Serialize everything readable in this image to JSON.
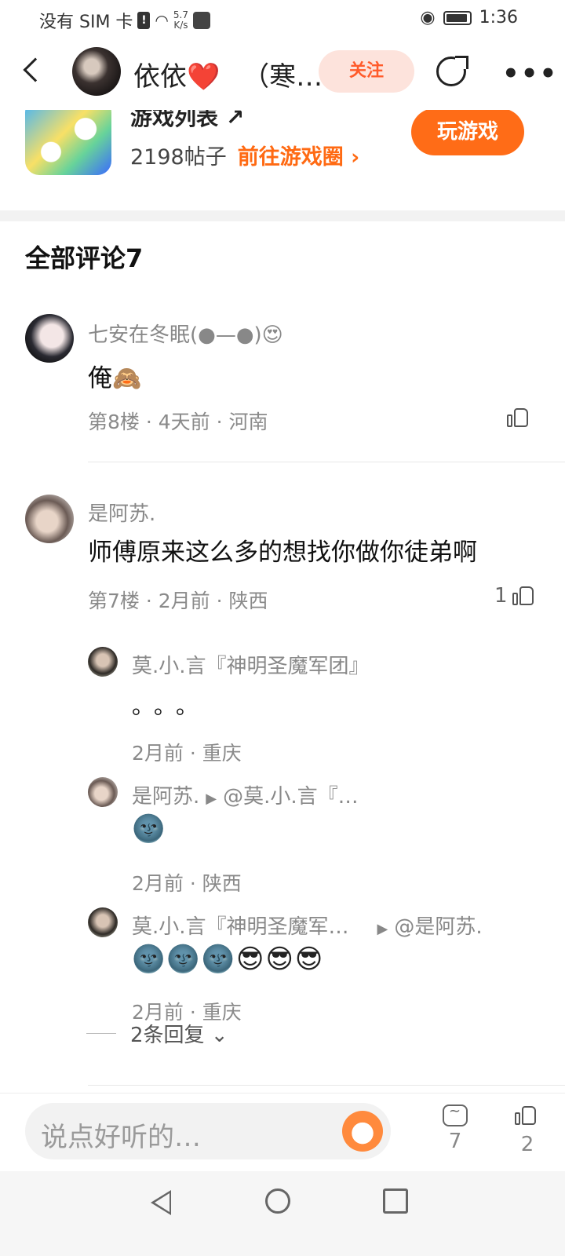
{
  "status_bar": {
    "sim_text": "没有 SIM 卡",
    "net_speed_value": "5.7",
    "net_speed_unit": "K/s",
    "time": "1:36"
  },
  "header": {
    "user_name": "依依",
    "heart_emoji": "❤️",
    "title_suffix": "（寒…",
    "follow_label": "关注",
    "more_label": "•••"
  },
  "game_card": {
    "title": "游戏列表 ↗",
    "posts": "2198帖子",
    "goto_label": "前往游戏圈 ›",
    "play_label": "玩游戏"
  },
  "comments_header": "全部评论7",
  "comments": [
    {
      "name": "七安在冬眠(●—●)",
      "name_emoji": "😍",
      "text": "俺",
      "text_emoji": "🙈",
      "meta": "第8楼 · 4天前 · 河南",
      "likes": ""
    },
    {
      "name": "是阿苏.",
      "text": "师傅原来这么多的想找你做你徒弟啊",
      "meta": "第7楼 · 2月前 · 陕西",
      "likes": "1"
    }
  ],
  "replies": [
    {
      "name": "莫.小.言『神明圣魔军团』",
      "reply_to": "",
      "text": "。。。",
      "meta": "2月前 · 重庆"
    },
    {
      "name": "是阿苏.",
      "reply_to": "@莫.小.言『…",
      "text": "🌚",
      "meta": "2月前 · 陕西"
    },
    {
      "name": "莫.小.言『神明圣魔军…",
      "reply_to": "@是阿苏.",
      "text": "🌚🌚🌚😎😎😎",
      "meta": "2月前 · 重庆"
    }
  ],
  "expand_label": "2条回复 ⌄",
  "bottom_bar": {
    "input_placeholder": "说点好听的…",
    "comment_count": "7",
    "like_count": "2"
  }
}
